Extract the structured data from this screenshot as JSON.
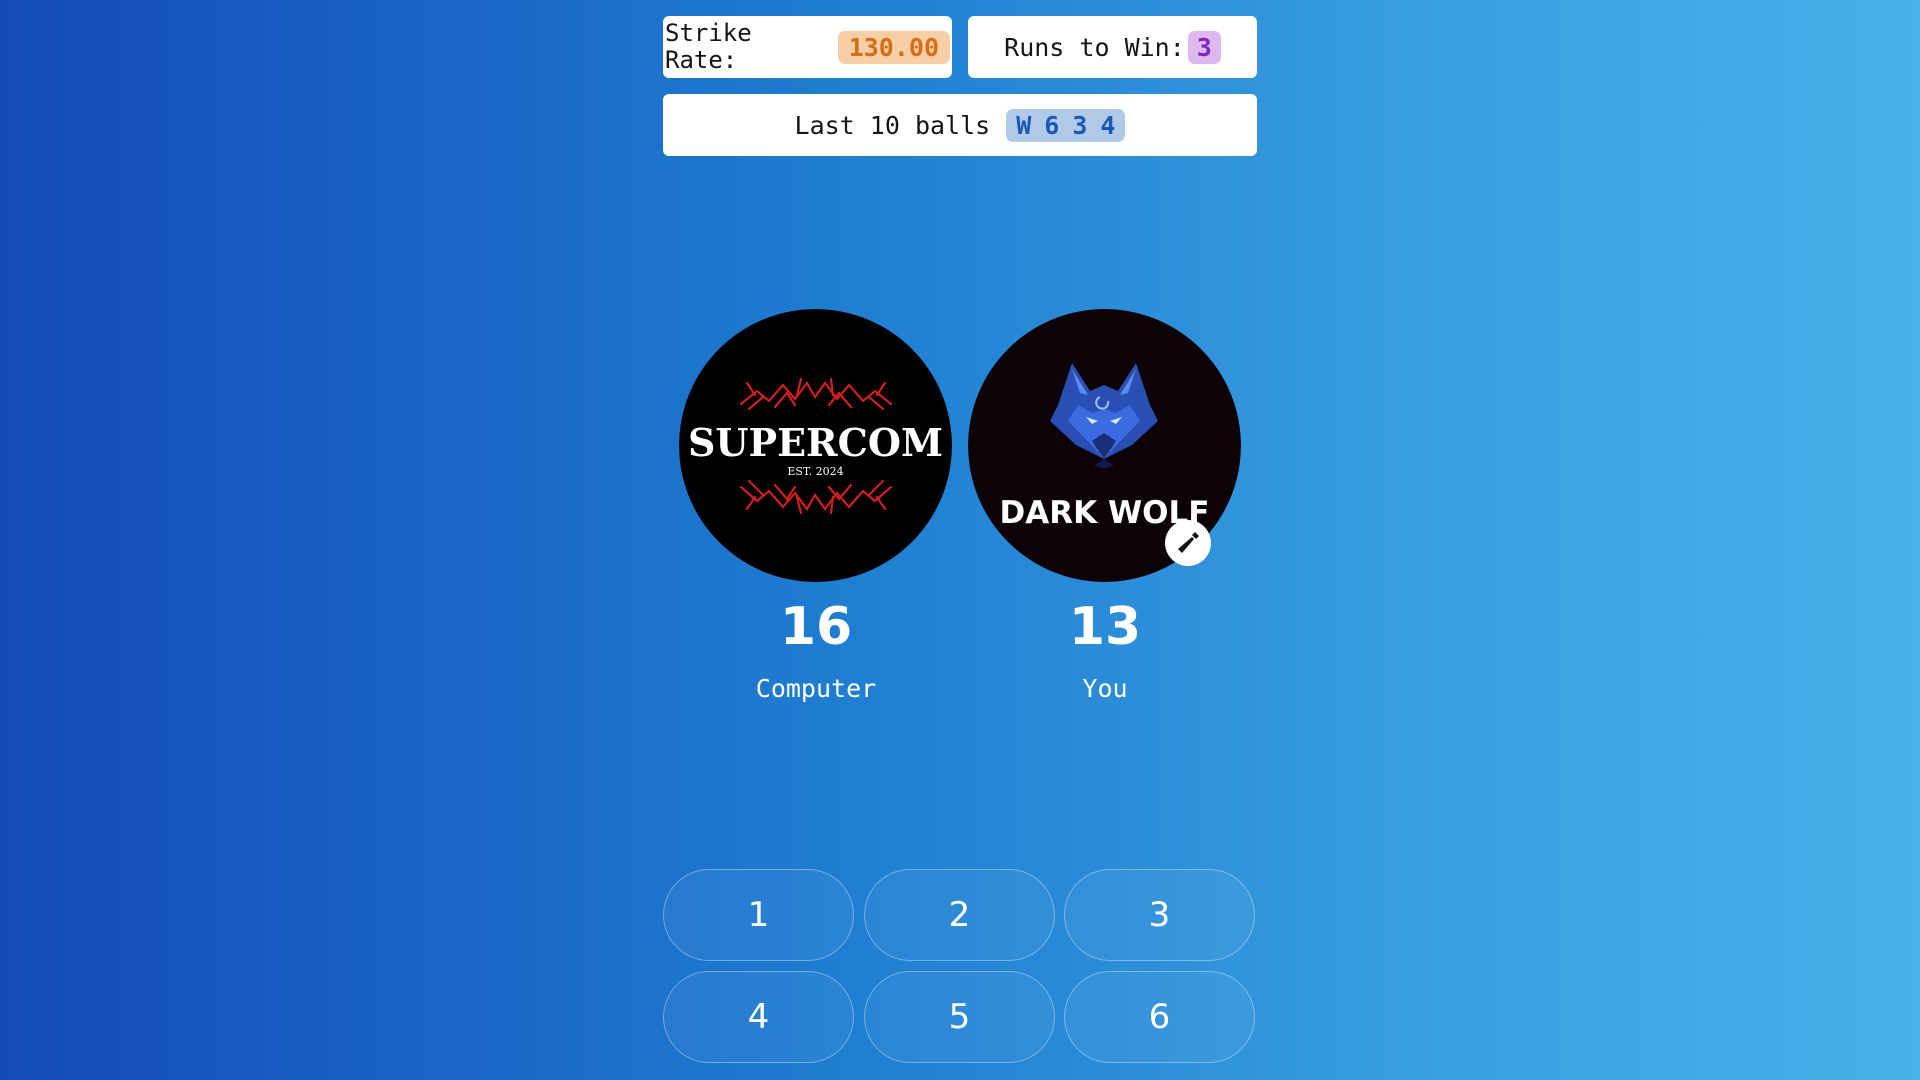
{
  "stats": {
    "strike_rate_label": "Strike Rate:",
    "strike_rate_value": "130.00",
    "runs_to_win_label": "Runs to Win:",
    "runs_to_win_value": "3",
    "last_balls_label": "Last 10 balls",
    "last_balls": [
      "W",
      "6",
      "3",
      "4"
    ]
  },
  "teams": {
    "computer": {
      "name": "Computer",
      "score": "16",
      "logo_text": "SUPERCOM",
      "logo_subtext": "EST. 2024"
    },
    "you": {
      "name": "You",
      "score": "13",
      "logo_text": "DARK WOLF",
      "batting_icon": "cricket-bat-icon"
    }
  },
  "run_buttons": [
    "1",
    "2",
    "3",
    "4",
    "5",
    "6"
  ],
  "colors": {
    "strike_badge_bg": "#f6cfa6",
    "strike_badge_text": "#d86d13",
    "runs_badge_bg": "#ddb7ee",
    "runs_badge_text": "#7c28b8",
    "balls_badge_bg": "#b1c9e8",
    "balls_badge_text": "#1c56b7"
  }
}
